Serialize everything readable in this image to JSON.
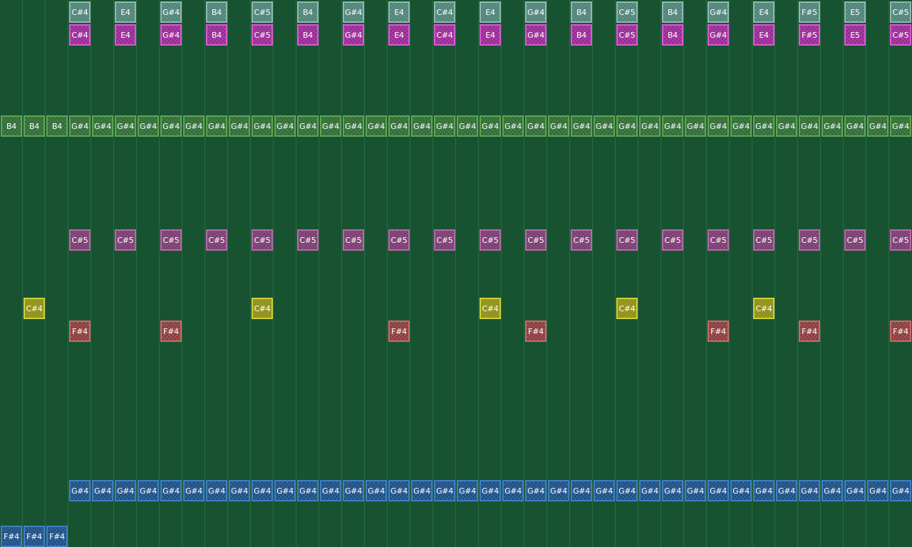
{
  "tracks": [
    {
      "id": "top",
      "color": "#4f8378",
      "border": "#8fb9b0",
      "notes": [
        "C#4",
        "E4",
        "G#4",
        "B4",
        "C#5",
        "B4",
        "G#4",
        "E4",
        "C#4",
        "E4",
        "G#4",
        "B4",
        "C#5",
        "B4",
        "G#4",
        "E4",
        "F#5",
        "E5",
        "C#5"
      ]
    },
    {
      "id": "magenta",
      "color": "#9a2a96",
      "border": "#d65bd0",
      "notes": [
        "C#4",
        "E4",
        "G#4",
        "B4",
        "C#5",
        "B4",
        "G#4",
        "E4",
        "C#4",
        "E4",
        "G#4",
        "B4",
        "C#5",
        "B4",
        "G#4",
        "E4",
        "F#5",
        "E5",
        "C#5"
      ]
    },
    {
      "id": "green",
      "color": "#2f6c36",
      "border": "#5fa452",
      "notes": [
        "B4",
        "B4",
        "B4",
        "G#4",
        "G#4",
        "G#4",
        "G#4",
        "G#4",
        "G#4",
        "G#4",
        "G#4",
        "G#4",
        "G#4",
        "G#4",
        "G#4",
        "G#4",
        "G#4",
        "G#4",
        "G#4",
        "G#4",
        "G#4",
        "G#4",
        "G#4",
        "G#4",
        "G#4",
        "G#4",
        "G#4",
        "G#4",
        "G#4",
        "G#4",
        "G#4",
        "G#4",
        "G#4",
        "G#4",
        "G#4",
        "G#4",
        "G#4",
        "G#4",
        "G#4",
        "G#4"
      ]
    },
    {
      "id": "purple",
      "color": "#7a3c70",
      "border": "#b46aa8",
      "notes": [
        "C#5",
        "C#5",
        "C#5",
        "C#5",
        "C#5",
        "C#5",
        "C#5",
        "C#5",
        "C#5",
        "C#5",
        "C#5",
        "C#5",
        "C#5",
        "C#5",
        "C#5",
        "C#5",
        "C#5",
        "C#5",
        "C#5"
      ]
    },
    {
      "id": "yellow",
      "color": "#8f8f14",
      "border": "#cfcf3a",
      "notes": [
        "C#4",
        "C#4",
        "C#4",
        "C#4",
        "C#4"
      ]
    },
    {
      "id": "red",
      "color": "#8c3d3d",
      "border": "#c86a6a",
      "notes": [
        "F#4",
        "F#4",
        "F#4",
        "F#4",
        "F#4",
        "F#4",
        "F#4"
      ]
    },
    {
      "id": "blue",
      "color": "#1c4f86",
      "border": "#3f7fc3",
      "notes": [
        "G#4",
        "G#4",
        "G#4",
        "G#4",
        "G#4",
        "G#4",
        "G#4",
        "G#4",
        "G#4",
        "G#4",
        "G#4",
        "G#4",
        "G#4",
        "G#4",
        "G#4",
        "G#4",
        "G#4",
        "G#4",
        "G#4",
        "G#4",
        "G#4",
        "G#4",
        "G#4",
        "G#4",
        "G#4",
        "G#4",
        "G#4",
        "G#4",
        "G#4",
        "G#4",
        "G#4",
        "G#4",
        "G#4",
        "G#4",
        "G#4",
        "G#4",
        "G#4"
      ]
    },
    {
      "id": "blue-low",
      "color": "#1c4f86",
      "border": "#3f7fc3",
      "notes": [
        "F#4",
        "F#4",
        "F#4"
      ]
    }
  ]
}
